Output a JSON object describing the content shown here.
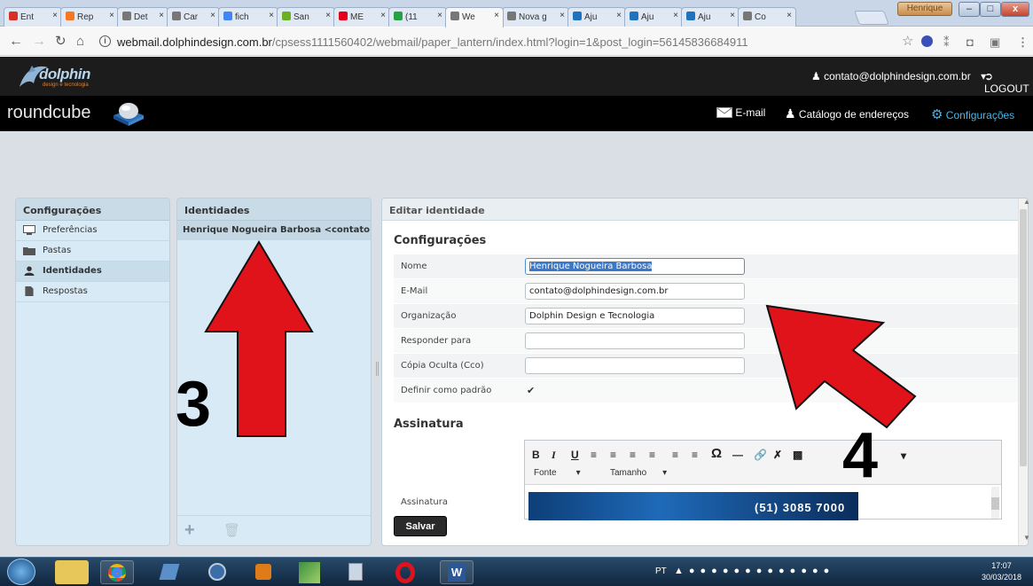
{
  "browser": {
    "tabs": [
      {
        "label": "Ent",
        "icon": "gmail-icon",
        "color": "#d93025"
      },
      {
        "label": "Rep",
        "icon": "hubspot-icon",
        "color": "#f57722"
      },
      {
        "label": "Det",
        "icon": "document-icon",
        "color": "#777777"
      },
      {
        "label": "Car",
        "icon": "document-icon",
        "color": "#777777"
      },
      {
        "label": "fich",
        "icon": "google-icon",
        "color": "#4285f4"
      },
      {
        "label": "San",
        "icon": "sanfona-icon",
        "color": "#6ab023"
      },
      {
        "label": "ME",
        "icon": "me-icon",
        "color": "#e4001b"
      },
      {
        "label": "(11",
        "icon": "whatsapp-icon",
        "color": "#25a244"
      },
      {
        "label": "We",
        "icon": "page-icon",
        "color": "#777777",
        "active": true
      },
      {
        "label": "Nova g",
        "icon": "page-icon",
        "color": "#777777"
      },
      {
        "label": "Aju",
        "icon": "help-icon",
        "color": "#1e73be"
      },
      {
        "label": "Aju",
        "icon": "help-icon",
        "color": "#1e73be"
      },
      {
        "label": "Aju",
        "icon": "help-icon",
        "color": "#1e73be"
      },
      {
        "label": "Co",
        "icon": "page-icon",
        "color": "#777777"
      }
    ],
    "tab_close": "×",
    "profile": "Henrique",
    "win_min": "–",
    "win_max": "□",
    "win_close": "x",
    "url_host": "webmail.dolphindesign.com.br",
    "url_path": "/cpsess1111560402/webmail/paper_lantern/index.html?login=1&post_login=56145836684911",
    "star": "☆"
  },
  "dolphin": {
    "logo_text": "dolphin",
    "logo_sub": "design e tecnologia",
    "user": "contato@dolphindesign.com.br",
    "user_caret": "▾",
    "logout": "LOGOUT"
  },
  "roundcube": {
    "logo": "roundcube",
    "nav_email": "E-mail",
    "nav_contacts": "Catálogo de endereços",
    "nav_settings": "Configurações"
  },
  "settings_panel": {
    "title": "Configurações",
    "items": [
      {
        "label": "Preferências",
        "icon": "monitor-icon"
      },
      {
        "label": "Pastas",
        "icon": "folder-icon"
      },
      {
        "label": "Identidades",
        "icon": "person-icon",
        "selected": true
      },
      {
        "label": "Respostas",
        "icon": "document-icon"
      }
    ]
  },
  "identities_panel": {
    "title": "Identidades",
    "item": "Henrique Nogueira Barbosa <contato...",
    "add": "+",
    "delete": "🗑"
  },
  "edit_panel": {
    "title": "Editar identidade",
    "section_settings": "Configurações",
    "fields": [
      {
        "label": "Nome",
        "value": "Henrique Nogueira Barbosa",
        "focused": true
      },
      {
        "label": "E-Mail",
        "value": "contato@dolphindesign.com.br"
      },
      {
        "label": "Organização",
        "value": "Dolphin Design e Tecnologia"
      },
      {
        "label": "Responder para",
        "value": ""
      },
      {
        "label": "Cópia Oculta (Cco)",
        "value": ""
      }
    ],
    "default_label": "Definir como padrão",
    "default_checked": "✔",
    "section_signature": "Assinatura",
    "signature_label": "Assinatura",
    "toolbar_font": "Fonte",
    "toolbar_size": "Tamanho",
    "save": "Salvar",
    "signature_phone": "(51) 3085 7000"
  },
  "annotations": {
    "arrow3_number": "3",
    "arrow4_number": "4",
    "arrow_color": "#e0121a"
  },
  "taskbar": {
    "lang": "PT",
    "time": "17:07",
    "date": "30/03/2018"
  }
}
